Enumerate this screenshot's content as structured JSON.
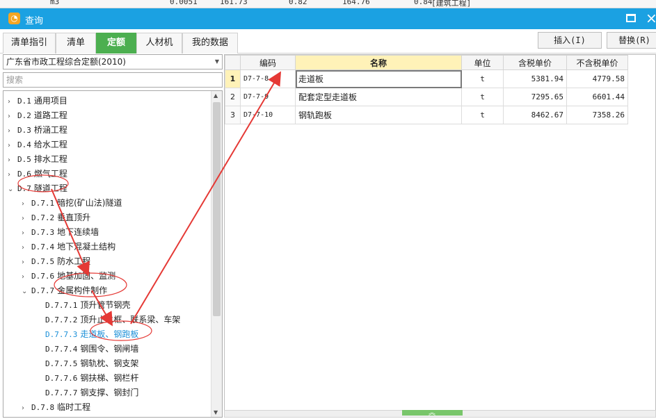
{
  "background_strip": {
    "cells": [
      "m3",
      "0.0051",
      "161.73",
      "0.82",
      "164.76",
      "0.84",
      "[建筑工程]"
    ]
  },
  "window": {
    "title": "查询",
    "icon": "app-logo-icon",
    "maximize_icon": "maximize-icon",
    "close_icon": "close-icon",
    "close_glyph": "×"
  },
  "tabs": [
    {
      "label": "清单指引",
      "active": false
    },
    {
      "label": "清单",
      "active": false
    },
    {
      "label": "定额",
      "active": true
    },
    {
      "label": "人材机",
      "active": false
    },
    {
      "label": "我的数据",
      "active": false
    }
  ],
  "toolbar": {
    "insert_label": "插入(I)",
    "replace_label": "替换(R)"
  },
  "quota_library": {
    "selected": "广东省市政工程综合定额(2010)"
  },
  "search": {
    "placeholder": "搜索",
    "value": ""
  },
  "tree": [
    {
      "code": "D.1",
      "label": "通用项目",
      "level": 0,
      "expanded": false
    },
    {
      "code": "D.2",
      "label": "道路工程",
      "level": 0,
      "expanded": false
    },
    {
      "code": "D.3",
      "label": "桥涵工程",
      "level": 0,
      "expanded": false
    },
    {
      "code": "D.4",
      "label": "给水工程",
      "level": 0,
      "expanded": false
    },
    {
      "code": "D.5",
      "label": "排水工程",
      "level": 0,
      "expanded": false
    },
    {
      "code": "D.6",
      "label": "燃气工程",
      "level": 0,
      "expanded": false
    },
    {
      "code": "D.7",
      "label": "隧道工程",
      "level": 0,
      "expanded": true
    },
    {
      "code": "D.7.1",
      "label": "暗挖(矿山法)隧道",
      "level": 1,
      "expanded": false
    },
    {
      "code": "D.7.2",
      "label": "垂直顶升",
      "level": 1,
      "expanded": false
    },
    {
      "code": "D.7.3",
      "label": "地下连续墙",
      "level": 1,
      "expanded": false
    },
    {
      "code": "D.7.4",
      "label": "地下混凝土结构",
      "level": 1,
      "expanded": false
    },
    {
      "code": "D.7.5",
      "label": "防水工程",
      "level": 1,
      "expanded": false
    },
    {
      "code": "D.7.6",
      "label": "地基加固、监测",
      "level": 1,
      "expanded": false
    },
    {
      "code": "D.7.7",
      "label": "金属构件制作",
      "level": 1,
      "expanded": true
    },
    {
      "code": "D.7.7.1",
      "label": "顶升管节钢壳",
      "level": 2
    },
    {
      "code": "D.7.7.2",
      "label": "顶升止水框、联系梁、车架",
      "level": 2
    },
    {
      "code": "D.7.7.3",
      "label": "走道板、钢跑板",
      "level": 2,
      "selected": true
    },
    {
      "code": "D.7.7.4",
      "label": "钢围令、钢闸墙",
      "level": 2
    },
    {
      "code": "D.7.7.5",
      "label": "钢轨枕、钢支架",
      "level": 2
    },
    {
      "code": "D.7.7.6",
      "label": "钢扶梯、钢栏杆",
      "level": 2
    },
    {
      "code": "D.7.7.7",
      "label": "钢支撑、钢封门",
      "level": 2
    },
    {
      "code": "D.7.8",
      "label": "临时工程",
      "level": 1,
      "expanded": false
    }
  ],
  "table": {
    "headers": [
      "",
      "编码",
      "名称",
      "单位",
      "含税单价",
      "不含税单价"
    ],
    "rows": [
      {
        "index": "1",
        "code": "D7-7-8",
        "name": "走道板",
        "unit": "t",
        "price_with_tax": "5381.94",
        "price_without_tax": "4779.58"
      },
      {
        "index": "2",
        "code": "D7-7-9",
        "name": "配套定型走道板",
        "unit": "t",
        "price_with_tax": "7295.65",
        "price_without_tax": "6601.44"
      },
      {
        "index": "3",
        "code": "D7-7-10",
        "name": "钢轨跑板",
        "unit": "t",
        "price_with_tax": "8462.67",
        "price_without_tax": "7358.26"
      }
    ]
  },
  "colors": {
    "titlebar": "#1ba1e2",
    "active_tab": "#4caf50",
    "annotation": "#e53935",
    "selected_tree_item": "#1a8fd8",
    "name_header": "#fff2b8"
  },
  "icons": {
    "expand_collapsed": "chevron-right-icon",
    "expand_open": "chevron-down-icon",
    "dropdown": "dropdown-arrow-icon",
    "splitter": "chevron-up-icon"
  }
}
